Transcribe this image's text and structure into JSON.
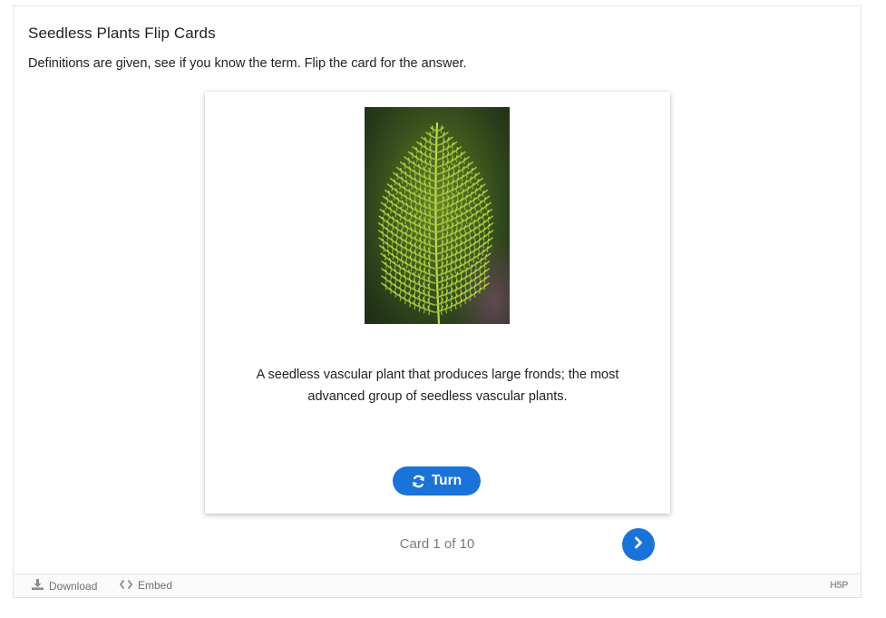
{
  "content": {
    "title": "Seedless Plants Flip Cards",
    "description": "Definitions are given, see if you know the term. Flip the card for the answer."
  },
  "card": {
    "image_subject": "fern frond",
    "text": "A seedless vascular plant that produces large fronds; the most advanced group of seedless vascular plants.",
    "turn_label": "Turn"
  },
  "navigation": {
    "progress_label": "Card 1 of 10",
    "current": 1,
    "total": 10
  },
  "footer": {
    "download_label": "Download",
    "embed_label": "Embed",
    "logo_text": "H5P"
  },
  "colors": {
    "accent": "#1a73d9",
    "progress_text": "#7a7a7a"
  }
}
